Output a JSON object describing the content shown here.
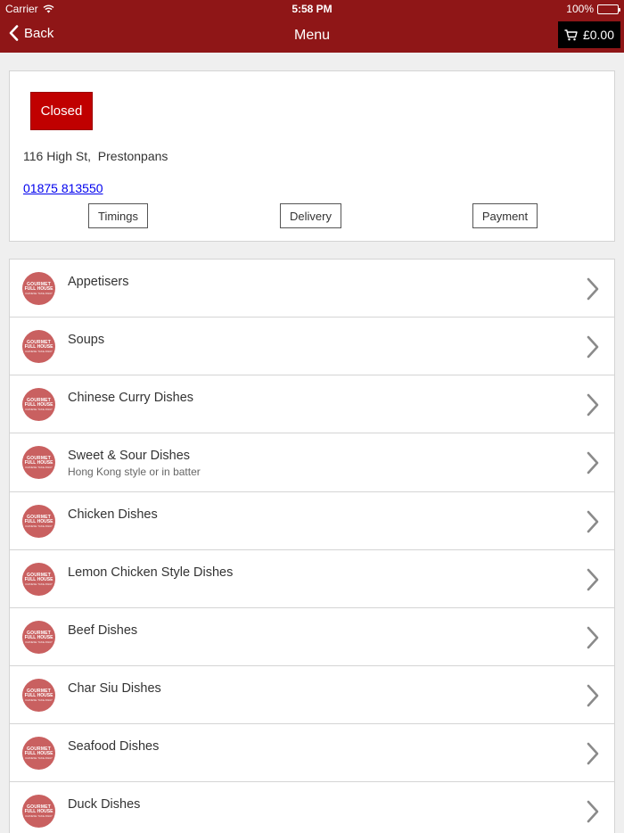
{
  "status_bar": {
    "carrier": "Carrier",
    "time": "5:58 PM",
    "battery": "100%"
  },
  "nav": {
    "back_label": "Back",
    "title": "Menu",
    "cart_total": "£0.00"
  },
  "shop": {
    "status": "Closed",
    "address": "116 High St,  Prestonpans",
    "phone": "01875 813550",
    "buttons": {
      "timings": "Timings",
      "delivery": "Delivery",
      "payment": "Payment"
    }
  },
  "menu": {
    "categories": [
      {
        "title": "Appetisers",
        "subtitle": ""
      },
      {
        "title": "Soups",
        "subtitle": ""
      },
      {
        "title": "Chinese Curry Dishes",
        "subtitle": ""
      },
      {
        "title": "Sweet & Sour Dishes",
        "subtitle": "Hong Kong style or in batter"
      },
      {
        "title": "Chicken Dishes",
        "subtitle": ""
      },
      {
        "title": "Lemon Chicken Style Dishes",
        "subtitle": ""
      },
      {
        "title": "Beef Dishes",
        "subtitle": ""
      },
      {
        "title": "Char Siu Dishes",
        "subtitle": ""
      },
      {
        "title": "Seafood Dishes",
        "subtitle": ""
      },
      {
        "title": "Duck Dishes",
        "subtitle": ""
      }
    ]
  },
  "colors": {
    "header": "#8f1617",
    "closed_badge": "#c00000",
    "logo": "#c96060"
  },
  "icons": {
    "back": "chevron-left-icon",
    "cart": "cart-icon",
    "row": "chevron-right-icon",
    "logo": "restaurant-logo"
  }
}
